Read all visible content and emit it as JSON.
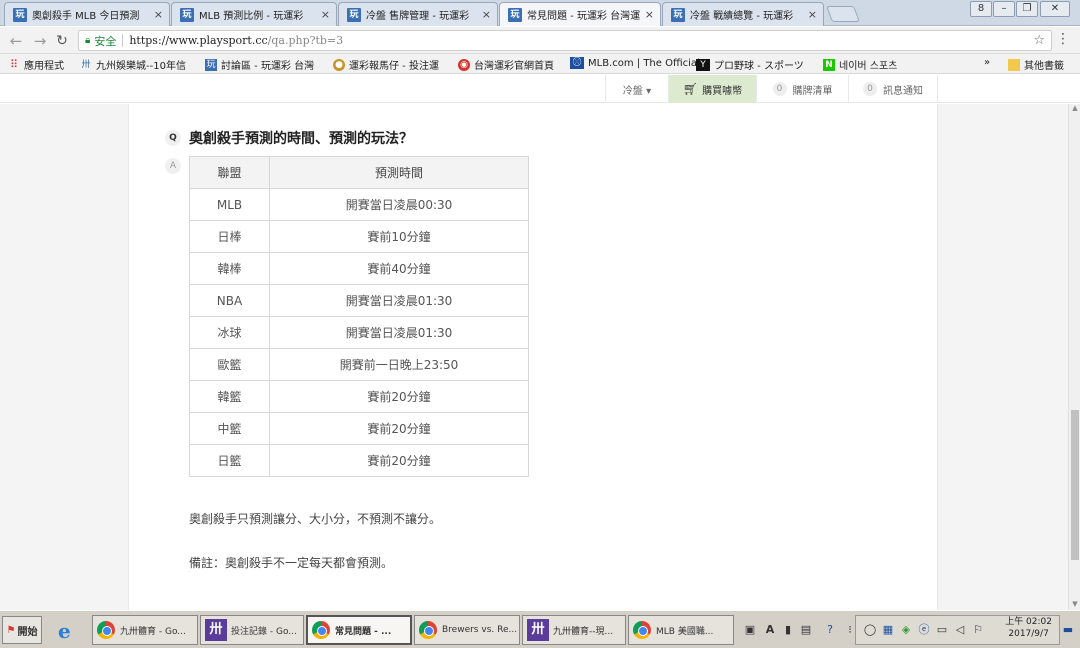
{
  "browser": {
    "tabs": [
      {
        "favicon": "玩",
        "title": "奧創殺手 MLB 今日預測"
      },
      {
        "favicon": "玩",
        "title": "MLB 預測比例 - 玩運彩"
      },
      {
        "favicon": "玩",
        "title": "冷盤 售牌管理 - 玩運彩"
      },
      {
        "favicon": "玩",
        "title": "常見問題 - 玩運彩 台灣運"
      },
      {
        "favicon": "玩",
        "title": "冷盤 戰績總覽 - 玩運彩"
      }
    ],
    "tab_close": "×",
    "window_controls": [
      "8",
      "–",
      "❐",
      "✕"
    ],
    "address": {
      "secure_label": "安全",
      "url_host": "https://www.playsport.cc",
      "url_path": "/qa.php?tb=3"
    },
    "bookmarks": [
      {
        "label": "應用程式",
        "icon": "apps-icon"
      },
      {
        "label": "九州娛樂城--10年信",
        "icon": "bookmark-icon"
      },
      {
        "label": "討論區 - 玩運彩 台灣",
        "icon": "playsport-icon"
      },
      {
        "label": "運彩報馬仔 - 投注運",
        "icon": "horse-icon"
      },
      {
        "label": "台灣運彩官網首頁",
        "icon": "lottery-icon"
      },
      {
        "label": "MLB.com | The Official",
        "icon": "mlb-icon"
      },
      {
        "label": "プロ野球 - スポーツ",
        "icon": "yahoo-icon"
      },
      {
        "label": "네이버 스포츠",
        "icon": "naver-icon"
      }
    ],
    "bookmarks_more": "»",
    "other_bookmarks": "其他書籤"
  },
  "site_header": {
    "user_menu": "冷盤 ▾",
    "buy": "購買噱幣",
    "cart_count": "0",
    "cart": "購牌清單",
    "notify_count": "0",
    "notify": "訊息通知"
  },
  "faq": {
    "q_badge": "Q",
    "question": "奧創殺手預測的時間、預測的玩法？",
    "a_badge": "A",
    "table": {
      "headers": [
        "聯盟",
        "預測時間"
      ],
      "rows": [
        [
          "MLB",
          "開賽當日凌晨00:30"
        ],
        [
          "日棒",
          "賽前10分鐘"
        ],
        [
          "韓棒",
          "賽前40分鐘"
        ],
        [
          "NBA",
          "開賽當日凌晨01:30"
        ],
        [
          "冰球",
          "開賽當日凌晨01:30"
        ],
        [
          "歐籃",
          "開賽前一日晚上23:50"
        ],
        [
          "韓籃",
          "賽前20分鐘"
        ],
        [
          "中籃",
          "賽前20分鐘"
        ],
        [
          "日籃",
          "賽前20分鐘"
        ]
      ]
    },
    "note1": "奧創殺手只預測讓分、大小分，不預測不讓分。",
    "note2": "備註：奧創殺手不一定每天都會預測。"
  },
  "taskbar": {
    "start": "開始",
    "items": [
      {
        "icon": "chrome",
        "label": "九卅體育 - Go..."
      },
      {
        "icon": "tile",
        "label": "投注記錄 - Go..."
      },
      {
        "icon": "chrome",
        "label": "常見問題 - ..."
      },
      {
        "icon": "chrome",
        "label": "Brewers vs. Re..."
      },
      {
        "icon": "tile",
        "label": "九卅體育--現..."
      },
      {
        "icon": "chrome",
        "label": "MLB 美國職..."
      }
    ],
    "clock_time": "上午 02:02",
    "clock_date": "2017/9/7"
  }
}
